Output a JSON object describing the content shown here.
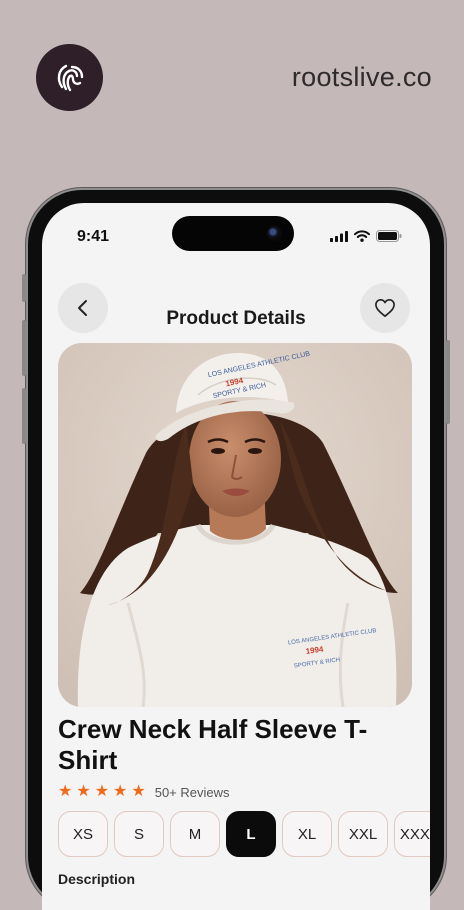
{
  "brand": {
    "logo_icon": "fingerprint-icon",
    "site_url": "rootslive.co"
  },
  "status_bar": {
    "time": "9:41",
    "icons": [
      "signal-icon",
      "wifi-icon",
      "battery-icon"
    ]
  },
  "header": {
    "title": "Product Details",
    "back_icon": "chevron-left-icon",
    "favorite_icon": "heart-icon"
  },
  "product": {
    "title": "Crew Neck Half Sleeve T-Shirt",
    "rating": 5,
    "reviews_label": "50+ Reviews",
    "cap_text_line1": "LOS ANGELES ATHLETIC CLUB",
    "cap_text_line2": "1994",
    "cap_text_line3": "SPORTY & RICH",
    "sizes": [
      "XS",
      "S",
      "M",
      "L",
      "XL",
      "XXL",
      "XXXL"
    ],
    "selected_size": "L",
    "description_label": "Description"
  },
  "colors": {
    "accent": "#f06a1a",
    "selected_bg": "#0b0b0b",
    "page_bg": "#c4b8b9",
    "logo_bg": "#2f1f29"
  }
}
